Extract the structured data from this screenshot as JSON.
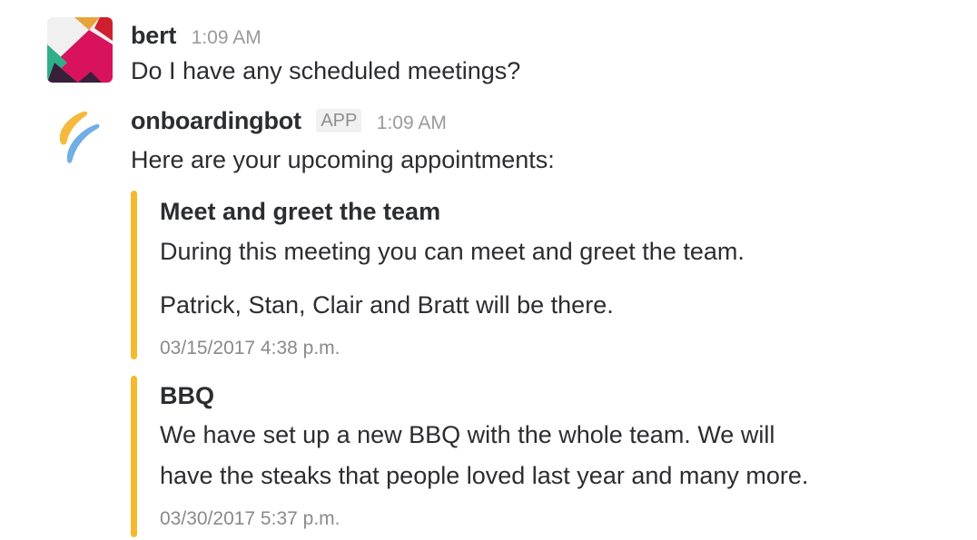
{
  "messages": [
    {
      "username": "bert",
      "time": "1:09 AM",
      "text": "Do I have any scheduled meetings?",
      "avatar_icon": "colorful-geometric-avatar-icon"
    },
    {
      "username": "onboardingbot",
      "badge": "APP",
      "time": "1:09 AM",
      "text": "Here are your upcoming appointments:",
      "avatar_icon": "brush-strokes-logo-icon"
    }
  ],
  "attachments": [
    {
      "title": "Meet and greet the team",
      "lines": [
        "During this meeting you can meet and greet the team.",
        "Patrick, Stan, Clair and Bratt will be there."
      ],
      "footer": "03/15/2017 4:38 p.m.",
      "color": "#f4b92e"
    },
    {
      "title": "BBQ",
      "lines": [
        "We have set up a new BBQ with the whole team. We will",
        "have the steaks that people loved last year and many more."
      ],
      "footer": "03/30/2017 5:37 p.m.",
      "color": "#f4b92e"
    }
  ]
}
